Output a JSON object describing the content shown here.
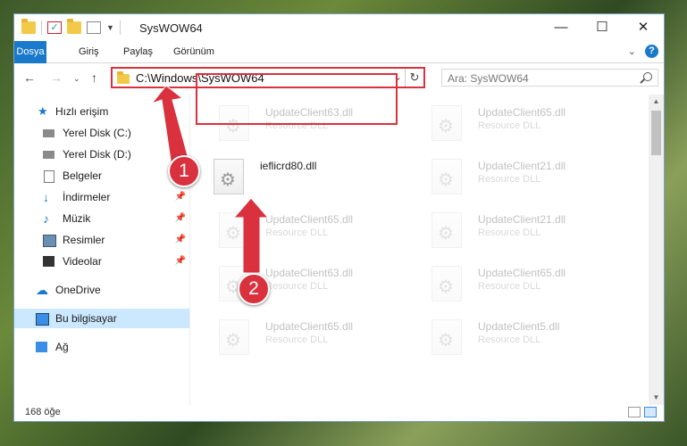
{
  "window": {
    "title": "SysWOW64",
    "controls": {
      "minimize": "—",
      "maximize": "☐",
      "close": "✕"
    }
  },
  "ribbon": {
    "tabs": [
      "Dosya",
      "Giriş",
      "Paylaş",
      "Görünüm"
    ],
    "help": "?"
  },
  "address": {
    "path": "C:\\Windows\\SysWOW64",
    "search_placeholder": "Ara: SysWOW64"
  },
  "sidebar": {
    "items": [
      {
        "label": "Hızlı erişim",
        "icon": "star-icon"
      },
      {
        "label": "Yerel Disk (C:)",
        "icon": "drive-icon"
      },
      {
        "label": "Yerel Disk (D:)",
        "icon": "drive-icon"
      },
      {
        "label": "Belgeler",
        "icon": "document-icon"
      },
      {
        "label": "İndirmeler",
        "icon": "download-icon"
      },
      {
        "label": "Müzik",
        "icon": "music-icon"
      },
      {
        "label": "Resimler",
        "icon": "pictures-icon"
      },
      {
        "label": "Videolar",
        "icon": "video-icon"
      },
      {
        "label": "OneDrive",
        "icon": "cloud-icon"
      },
      {
        "label": "Bu bilgisayar",
        "icon": "computer-icon"
      },
      {
        "label": "Ağ",
        "icon": "network-icon"
      }
    ]
  },
  "files": {
    "highlighted": {
      "name": "ieflicrd80.dll"
    },
    "faded": [
      {
        "name": "UpdateClient63.dll",
        "type": "Resource DLL"
      },
      {
        "name": "UpdateClient65.dll",
        "type": "Resource DLL"
      },
      {
        "name": "UpdateClient21.dll",
        "type": "Resource DLL"
      },
      {
        "name": "UpdateClient65.dll",
        "type": "Resource DLL"
      },
      {
        "name": "UpdateClient21.dll",
        "type": "Resource DLL"
      },
      {
        "name": "UpdateClient63.dll",
        "type": "Resource DLL"
      },
      {
        "name": "UpdateClient65.dll",
        "type": "Resource DLL"
      },
      {
        "name": "UpdateClient65.dll",
        "type": "Resource DLL"
      },
      {
        "name": "UpdateClient5.dll",
        "type": "Resource DLL"
      }
    ]
  },
  "status": {
    "count": "168 öğe"
  },
  "callouts": {
    "one": "1",
    "two": "2"
  },
  "colors": {
    "accent": "#1979ca",
    "highlight": "#d9313d",
    "selected": "#cce8ff"
  }
}
